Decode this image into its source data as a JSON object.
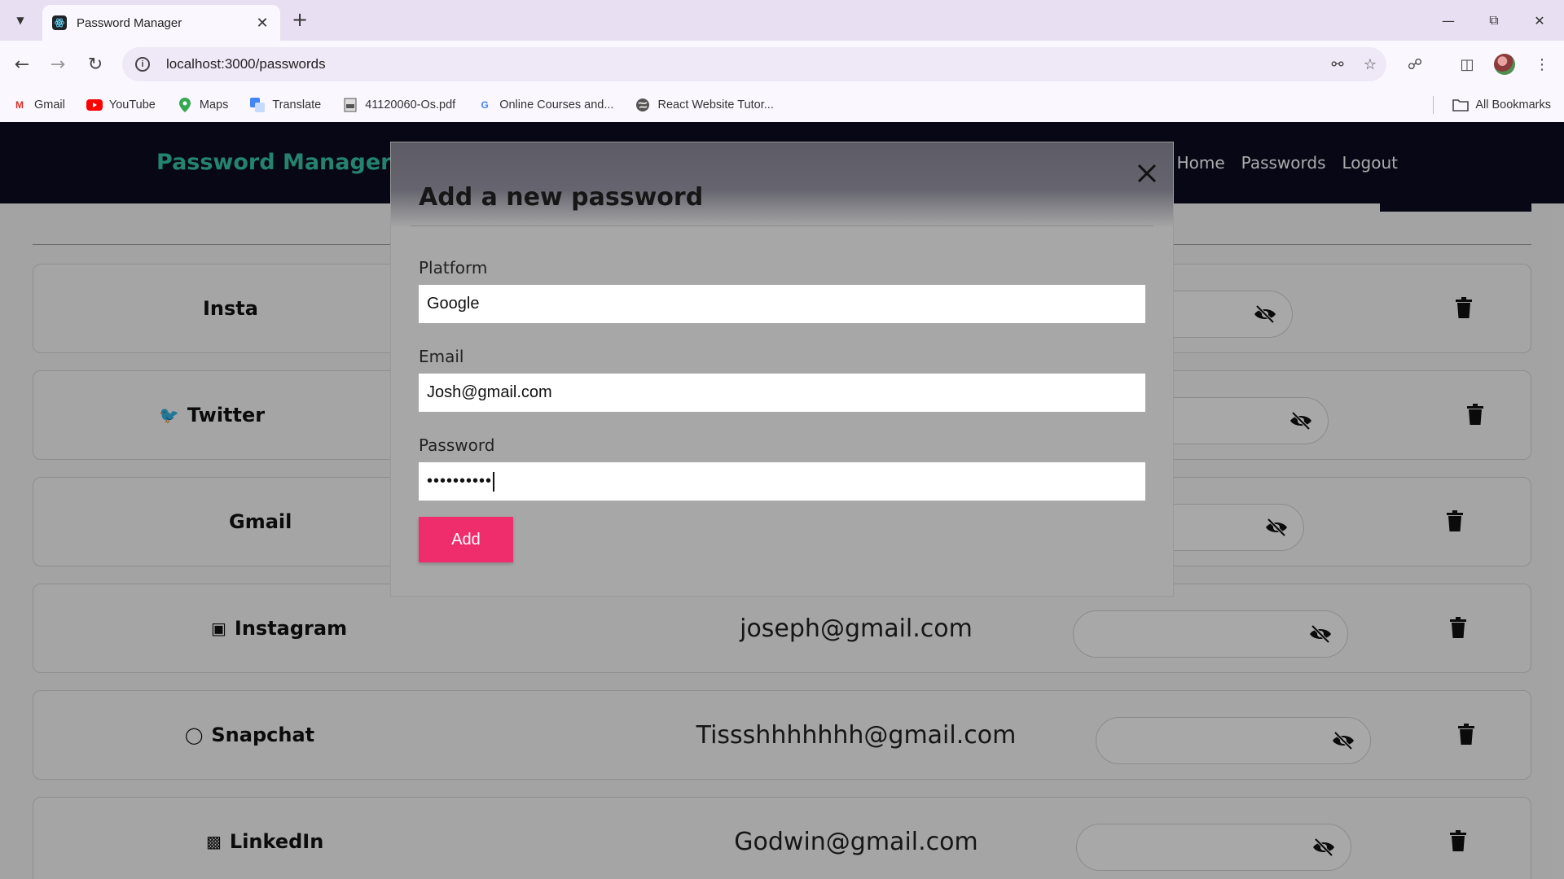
{
  "browser": {
    "tab_title": "Password Manager",
    "url": "localhost:3000/passwords",
    "bookmarks": [
      {
        "label": "Gmail",
        "icon": "gmail-icon"
      },
      {
        "label": "YouTube",
        "icon": "youtube-icon"
      },
      {
        "label": "Maps",
        "icon": "maps-icon"
      },
      {
        "label": "Translate",
        "icon": "translate-icon"
      },
      {
        "label": "41120060-Os.pdf",
        "icon": "pdf-icon"
      },
      {
        "label": "Online Courses and...",
        "icon": "google-icon"
      },
      {
        "label": "React Website Tutor...",
        "icon": "globe-icon"
      }
    ],
    "all_bookmarks": "All Bookmarks"
  },
  "site": {
    "brand": "Password Manager",
    "brand_color": "#36c3a4",
    "nav": [
      "Home",
      "Passwords",
      "Logout"
    ]
  },
  "entries": [
    {
      "platform": "Insta",
      "icon": "",
      "email": ""
    },
    {
      "platform": "Twitter",
      "icon": "twitter-icon",
      "email": ""
    },
    {
      "platform": "Gmail",
      "icon": "",
      "email": ""
    },
    {
      "platform": "Instagram",
      "icon": "instagram-icon",
      "email": "joseph@gmail.com"
    },
    {
      "platform": "Snapchat",
      "icon": "snapchat-icon",
      "email": "Tissshhhhhhh@gmail.com"
    },
    {
      "platform": "LinkedIn",
      "icon": "linkedin-icon",
      "email": "Godwin@gmail.com"
    }
  ],
  "modal": {
    "title": "Add a new password",
    "platform_label": "Platform",
    "platform_value": "Google",
    "email_label": "Email",
    "email_value": "Josh@gmail.com",
    "password_label": "Password",
    "password_value": "••••••••••",
    "add_label": "Add",
    "add_color": "#ef2c6c"
  }
}
